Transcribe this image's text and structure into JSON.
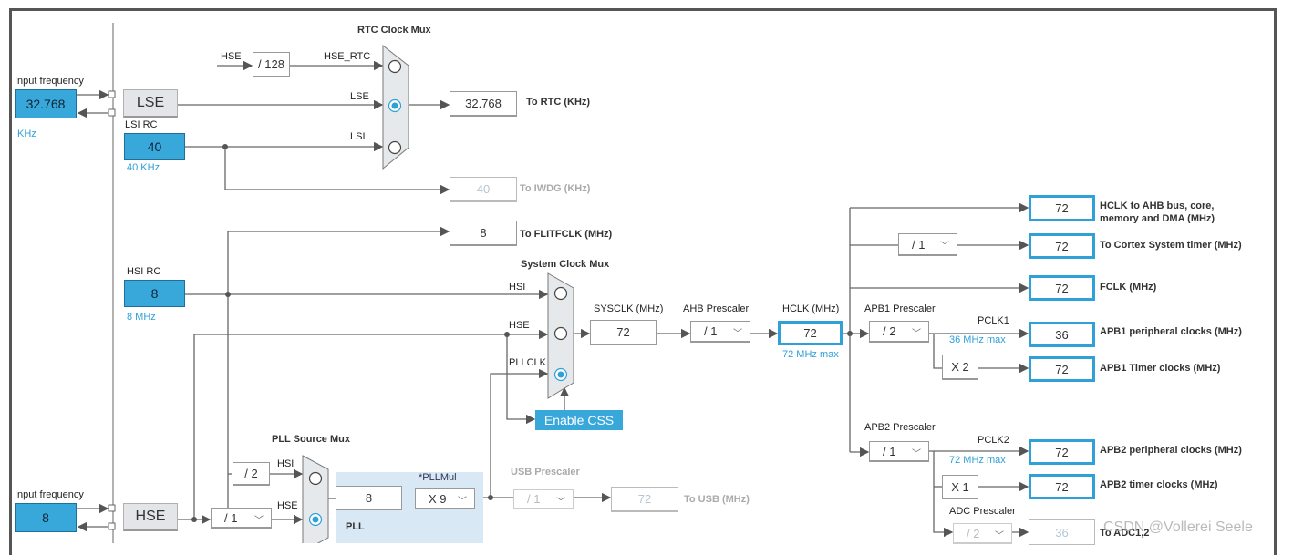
{
  "lse_input": {
    "label": "Input frequency",
    "value": "32.768",
    "unit": "KHz"
  },
  "lse_label": "LSE",
  "lsi": {
    "label": "LSI RC",
    "value": "40",
    "unit": "40 KHz"
  },
  "hsi": {
    "label": "HSI RC",
    "value": "8",
    "unit": "8 MHz"
  },
  "hse_input": {
    "label": "Input frequency",
    "value": "8"
  },
  "hse_label": "HSE",
  "rtc_mux": {
    "title": "RTC Clock Mux",
    "in_hse": "HSE",
    "div": "/ 128",
    "hse_rtc": "HSE_RTC",
    "lse": "LSE",
    "lsi": "LSI",
    "selected": "LSE"
  },
  "rtc_out": {
    "value": "32.768",
    "label": "To RTC (KHz)"
  },
  "iwdg_out": {
    "value": "40",
    "label": "To IWDG (KHz)"
  },
  "flit_out": {
    "value": "8",
    "label": "To FLITFCLK (MHz)"
  },
  "sys_mux": {
    "title": "System Clock Mux",
    "hsi": "HSI",
    "hse": "HSE",
    "pllclk": "PLLCLK",
    "selected": "PLLCLK"
  },
  "sysclk": {
    "label": "SYSCLK (MHz)",
    "value": "72"
  },
  "ahb": {
    "label": "AHB Prescaler",
    "value": "/ 1"
  },
  "hclk": {
    "label": "HCLK (MHz)",
    "value": "72",
    "max": "72 MHz max"
  },
  "enable_css": "Enable CSS",
  "pll_mux": {
    "title": "PLL Source Mux",
    "div_hsi": "/ 2",
    "hsi": "HSI",
    "hse": "HSE",
    "hse_div": "/ 1",
    "selected": "HSE"
  },
  "pll": {
    "label": "PLL",
    "mul_label": "*PLLMul",
    "value": "8",
    "mul": "X 9"
  },
  "usb": {
    "label": "USB Prescaler",
    "value": "/ 1",
    "out": "72",
    "out_label": "To USB (MHz)"
  },
  "outputs": [
    {
      "value": "72",
      "label": "HCLK to AHB bus, core, memory and DMA (MHz)"
    },
    {
      "value": "72",
      "label": "To Cortex System timer (MHz)"
    },
    {
      "value": "72",
      "label": "FCLK (MHz)"
    },
    {
      "value": "36",
      "label": "APB1 peripheral clocks (MHz)"
    },
    {
      "value": "72",
      "label": "APB1 Timer clocks (MHz)"
    },
    {
      "value": "72",
      "label": "APB2 peripheral clocks (MHz)"
    },
    {
      "value": "72",
      "label": "APB2 timer clocks (MHz)"
    },
    {
      "value": "36",
      "label": "To ADC1,2"
    }
  ],
  "cortex_div": "/ 1",
  "apb1": {
    "label": "APB1 Prescaler",
    "value": "/ 2",
    "pclk": "PCLK1",
    "max": "36 MHz max",
    "timer_mul": "X 2"
  },
  "apb2": {
    "label": "APB2 Prescaler",
    "value": "/ 1",
    "pclk": "PCLK2",
    "max": "72 MHz max",
    "timer_mul": "X 1"
  },
  "adc": {
    "label": "ADC Prescaler",
    "value": "/ 2"
  },
  "watermark": "CSDN @Vollerei Seele",
  "colors": {
    "accent": "#38a8db",
    "pll_bg": "#d9e8f5"
  }
}
